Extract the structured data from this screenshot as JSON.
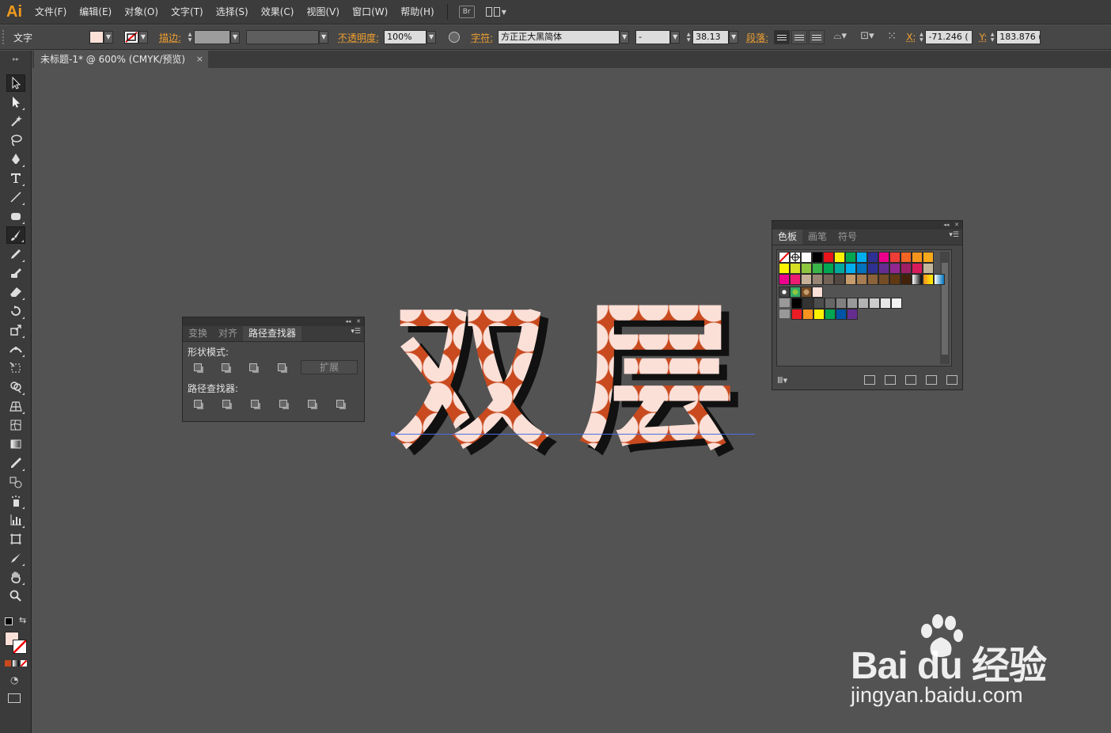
{
  "app": {
    "logo_text": "Ai",
    "menu": [
      "文件(F)",
      "编辑(E)",
      "对象(O)",
      "文字(T)",
      "选择(S)",
      "效果(C)",
      "视图(V)",
      "窗口(W)",
      "帮助(H)"
    ],
    "bridge_label": "Br"
  },
  "control_bar": {
    "selection_type": "文字",
    "fill_color": "#fbe0d8",
    "stroke_label": "描边:",
    "opacity_label": "不透明度:",
    "opacity_value": "100%",
    "character_label": "字符:",
    "font_name": "方正正大黑简体",
    "font_style": "-",
    "font_size": "38.13",
    "paragraph_label": "段落:",
    "x_label": "X:",
    "x_value": "-71.246 (",
    "y_label": "Y:",
    "y_value": "183.876 ("
  },
  "document": {
    "tab_title": "未标题-1* @ 600% (CMYK/预览)",
    "close_glyph": "×"
  },
  "artwork": {
    "text_left": "双",
    "text_right": "层",
    "pattern_light": "#fbe0d8",
    "pattern_dark": "#c84a1e",
    "shadow_color": "#111111"
  },
  "pathfinder_panel": {
    "tabs": [
      "变换",
      "对齐",
      "路径查找器"
    ],
    "active_tab": 2,
    "shape_modes_label": "形状模式:",
    "expand_label": "扩展",
    "pathfinders_label": "路径查找器:"
  },
  "swatches_panel": {
    "tabs": [
      "色板",
      "画笔",
      "符号"
    ],
    "active_tab": 0,
    "rows": [
      [
        "none",
        "registration",
        "#ffffff",
        "#000000",
        "#e8151b",
        "#fff200",
        "#00a650",
        "#00aeef",
        "#2e3192",
        "#ec008c",
        "#ef3e36",
        "#f26522",
        "#f7941d",
        "#f7a81b"
      ],
      [
        "#fff200",
        "#d7df23",
        "#8dc63f",
        "#39b54a",
        "#00a651",
        "#00a99d",
        "#00aeef",
        "#0072bc",
        "#2e3192",
        "#662d91",
        "#92278f",
        "#9e1f63",
        "#d91b5c",
        "#c2b59b"
      ],
      [
        "#ec008c",
        "#ed1c73",
        "#c7b299",
        "#998675",
        "#736357",
        "#534741",
        "#c69c6d",
        "#a67c52",
        "#8c6239",
        "#754c24",
        "#603913",
        "#42210b",
        "gradient-bw",
        "gradient-orange",
        "gradient-blue"
      ],
      [
        "pattern-a",
        "pattern-b",
        "pattern-c",
        "#fbe0d8"
      ],
      [
        "folder",
        "#000000",
        "#333333",
        "#4d4d4d",
        "#666666",
        "#808080",
        "#999999",
        "#b3b3b3",
        "#cccccc",
        "#e6e6e6",
        "#f2f2f2"
      ],
      [
        "folder",
        "#ed1c24",
        "#f7941d",
        "#fff200",
        "#00a651",
        "#0054a6",
        "#662d91"
      ]
    ]
  },
  "watermark": {
    "brand": "Bai du 经验",
    "url": "jingyan.baidu.com"
  }
}
